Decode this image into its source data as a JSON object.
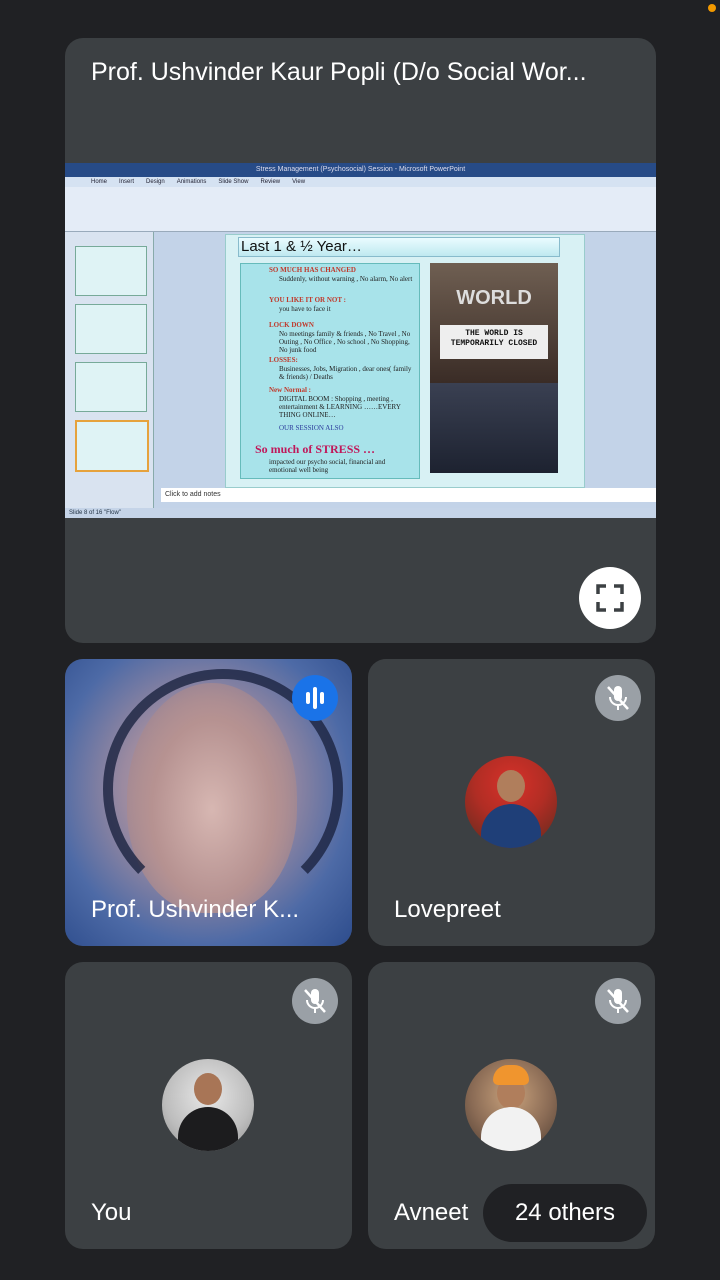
{
  "presenter": {
    "title": "Prof. Ushvinder Kaur Popli (D/o Social Wor...",
    "fullscreen_icon": "fullscreen-icon"
  },
  "shared_screen": {
    "window_title": "Stress Management (Psychosocial) Session - Microsoft PowerPoint",
    "ribbon_tabs": [
      "Home",
      "Insert",
      "Design",
      "Animations",
      "Slide Show",
      "Review",
      "View"
    ],
    "slide": {
      "title": "Last 1 & ½  Year…",
      "bullets": [
        {
          "heading": "SO MUCH HAS CHANGED",
          "detail": "Suddenly, without warning , No alarm, No alert"
        },
        {
          "heading": "YOU LIKE IT OR NOT :",
          "detail": "you have to face it"
        },
        {
          "heading": "LOCK DOWN",
          "detail": "No meetings family & friends , No Travel , No Outing , No Office , No school , No Shopping, No junk food"
        },
        {
          "heading": "LOSSES:",
          "detail": "Businesses, Jobs, Migration , dear ones( family & friends) / Deaths"
        },
        {
          "heading": "New Normal :",
          "detail": "DIGITAL BOOM : Shopping , meeting , entertainment & LEARNING ……EVERY THING ONLINE…"
        }
      ],
      "session_text": "OUR SESSION ALSO",
      "stress_heading": "So much of STRESS …",
      "stress_detail": "impacted our  psycho  social, financial and  emotional well being",
      "image_sign_top": "WORLD",
      "image_sign_text": "THE WORLD IS TEMPORARILY CLOSED"
    },
    "notes_placeholder": "Click to add notes",
    "status_bar": "Slide 8 of 16    \"Flow\""
  },
  "participants": [
    {
      "name": "Prof. Ushvinder K...",
      "state": "speaking",
      "indicator_icon": "audio-level-icon"
    },
    {
      "name": "Lovepreet",
      "state": "muted",
      "indicator_icon": "mic-off-icon"
    },
    {
      "name": "You",
      "state": "muted",
      "indicator_icon": "mic-off-icon"
    },
    {
      "name": "Avneet",
      "state": "muted",
      "indicator_icon": "mic-off-icon"
    }
  ],
  "others": {
    "label": "24 others"
  },
  "colors": {
    "background": "#202124",
    "tile": "#3c4043",
    "speaking": "#1a73e8",
    "muted": "#9aa0a6",
    "notification_dot": "#f29900"
  }
}
